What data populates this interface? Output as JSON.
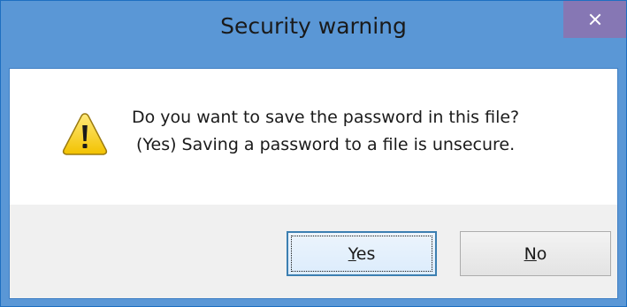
{
  "window": {
    "title": "Security warning"
  },
  "icons": {
    "warning": "warning-icon",
    "close": "close-icon"
  },
  "message": {
    "line1": "Do you want to save the password in this file?",
    "line2": "(Yes) Saving a password to a file is unsecure."
  },
  "buttons": {
    "yes": {
      "mnemonic": "Y",
      "rest": "es"
    },
    "no": {
      "mnemonic": "N",
      "rest": "o"
    }
  },
  "colors": {
    "titlebar": "#5a97d6",
    "close_button": "#8677b4",
    "button_area": "#f0f0f0",
    "default_button_border": "#3c7fb1"
  }
}
